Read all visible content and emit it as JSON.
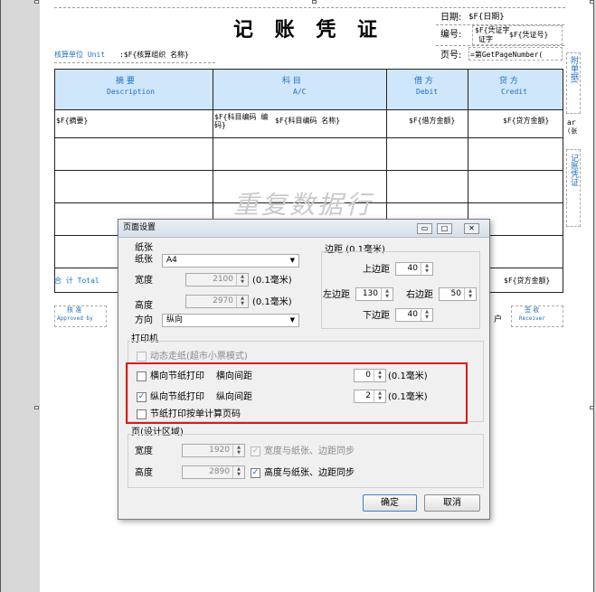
{
  "voucher": {
    "title": "记 账 凭 证",
    "date_label": "日期:",
    "date_value": "$F{日期}",
    "number_label": "编号:",
    "number_value1": "$F{凭证字",
    "number_value1b": "证字",
    "number_value2": "$F{凭证号}",
    "page_label": "页号:",
    "page_value": "=第GetPageNumber(",
    "unit_label": "核算单位 Unit",
    "unit_value": ":$F{核算组织 名称}",
    "col1_cn": "摘      要",
    "col1_en": "Description",
    "col2_cn": "科      目",
    "col2_en": "A/C",
    "col3_cn": "借 方",
    "col3_en": "Debit",
    "col4_cn": "贷 方",
    "col4_en": "Credit",
    "row_summary": "$F{摘要}",
    "row_account_code": "$F{科目编码 编码}",
    "row_account_name": "$F{科目编码 名称}",
    "row_debit": "$F{借方金额}",
    "row_credit": "$F{贷方金额}",
    "watermark": "重复数据行",
    "total_label": "合 计 Total",
    "total_credit": "$F{贷方金额}",
    "approved_label": "核    准",
    "approved_en": "Approved by",
    "receiver_label": "签    收",
    "receiver_en": "Receiver",
    "customer_fragment": "户",
    "side_label": "附单据(",
    "side_label2": "张",
    "side_label3": "记账凭证",
    "side_label4": "ar",
    "side_label5": "(张"
  },
  "dialog": {
    "title": "页面设置",
    "paper_group": "纸张",
    "paper_label": "纸张",
    "paper_value": "A4",
    "width_label": "宽度",
    "width_value": "2100",
    "width_unit": "(0.1毫米)",
    "height_label": "高度",
    "height_value": "2970",
    "height_unit": "(0.1毫米)",
    "orient_label": "方向",
    "orient_value": "纵向",
    "margin_group": "边距 (0.1毫米)",
    "top_label": "上边距",
    "top_value": "40",
    "left_label": "左边距",
    "left_value": "130",
    "right_label": "右边距",
    "right_value": "50",
    "bottom_label": "下边距",
    "bottom_value": "40",
    "printer_group": "打印机",
    "dynamic_paper": "动态走纸(超市小票模式)",
    "h_section_print": "横向节纸打印",
    "h_spacing_label": "横向间距",
    "h_spacing_value": "0",
    "h_spacing_unit": "(0.1毫米)",
    "v_section_print": "纵向节纸打印",
    "v_spacing_label": "纵向间距",
    "v_spacing_value": "2",
    "v_spacing_unit": "(0.1毫米)",
    "page_calc": "节纸打印按单计算页码",
    "design_group": "页(设计区域)",
    "d_width_label": "宽度",
    "d_width_value": "1920",
    "d_width_sync": "宽度与纸张、边距同步",
    "d_height_label": "高度",
    "d_height_value": "2890",
    "d_height_sync": "高度与纸张、边距同步",
    "ok": "确定",
    "cancel": "取消",
    "btn_min": "▭",
    "btn_max": "□",
    "btn_close": "✕"
  },
  "colors": {
    "header_band": "#cfe6fb",
    "accent_blue": "#1f6fbf",
    "highlight": "#e01818"
  }
}
